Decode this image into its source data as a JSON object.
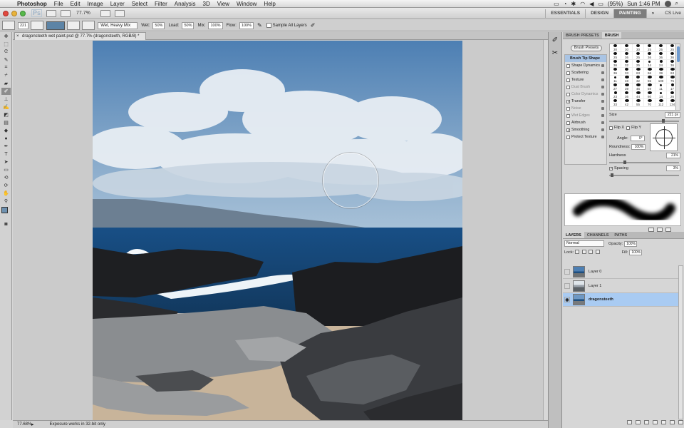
{
  "menubar": {
    "app": "Photoshop",
    "menus": [
      "File",
      "Edit",
      "Image",
      "Layer",
      "Select",
      "Filter",
      "Analysis",
      "3D",
      "View",
      "Window",
      "Help"
    ],
    "battery": "(95%)",
    "clock": "Sun 1:46 PM"
  },
  "appbar": {
    "logo": "Ps",
    "zoom": "77.7%",
    "workspaces": [
      "ESSENTIALS",
      "DESIGN",
      "PAINTING"
    ],
    "active_workspace": "PAINTING",
    "more": "»",
    "cs_live": "CS Live"
  },
  "options": {
    "brush_size": "221",
    "mix_preset": "Wet, Heavy Mix",
    "wet_label": "Wet:",
    "wet": "50%",
    "load_label": "Load:",
    "load": "50%",
    "mix_label": "Mix:",
    "mix": "100%",
    "flow_label": "Flow:",
    "flow": "100%",
    "sample_all": "Sample All Layers",
    "swatch_color": "#5d84a6"
  },
  "document": {
    "tab": "dragonsteeth wet paint.psd @ 77.7% (dragonsteeth, RGB/8) *"
  },
  "status": {
    "zoom": "77.68%",
    "message": "Exposure works in 32-bit only"
  },
  "brush_panel": {
    "tabs": [
      "BRUSH PRESETS",
      "BRUSH"
    ],
    "active_tab": "BRUSH",
    "presets_button": "Brush Presets",
    "options": [
      {
        "label": "Brush Tip Shape",
        "state": "head"
      },
      {
        "label": "Shape Dynamics",
        "state": "off"
      },
      {
        "label": "Scattering",
        "state": "off"
      },
      {
        "label": "Texture",
        "state": "off"
      },
      {
        "label": "Dual Brush",
        "state": "disabled"
      },
      {
        "label": "Color Dynamics",
        "state": "disabled"
      },
      {
        "label": "Transfer",
        "state": "on"
      },
      {
        "label": "Noise",
        "state": "disabled"
      },
      {
        "label": "Wet Edges",
        "state": "disabled"
      },
      {
        "label": "Airbrush",
        "state": "off"
      },
      {
        "label": "Smoothing",
        "state": "on"
      },
      {
        "label": "Protect Texture",
        "state": "off"
      }
    ],
    "tip_sizes": [
      "30",
      "30",
      "30",
      "25",
      "25",
      "25",
      "25",
      "36",
      "25",
      "36",
      "36",
      "36",
      "36",
      "32",
      "25",
      "14",
      "24",
      "36",
      "36",
      "33",
      "63",
      "66",
      "39",
      "63",
      "11",
      "48",
      "32",
      "55",
      "100",
      "75",
      "27",
      "39",
      "46",
      "59",
      "11",
      "17",
      "23",
      "36",
      "44",
      "60",
      "14",
      "26",
      "33",
      "42",
      "55",
      "70",
      "112",
      "134"
    ],
    "size_label": "Size",
    "size": "221 px",
    "flip_x": "Flip X",
    "flip_y": "Flip Y",
    "angle_label": "Angle:",
    "angle": "0°",
    "roundness_label": "Roundness:",
    "roundness": "100%",
    "hardness_label": "Hardness",
    "hardness": "21%",
    "spacing_label": "Spacing",
    "spacing": "3%"
  },
  "layers_panel": {
    "tabs": [
      "LAYERS",
      "CHANNELS",
      "PATHS"
    ],
    "active_tab": "LAYERS",
    "blend_mode": "Normal",
    "opacity_label": "Opacity:",
    "opacity": "100%",
    "lock_label": "Lock:",
    "fill_label": "Fill:",
    "fill": "100%",
    "layers": [
      {
        "name": "Layer 0",
        "visible": false,
        "selected": false
      },
      {
        "name": "Layer 1",
        "visible": false,
        "selected": false
      },
      {
        "name": "dragonsteeth",
        "visible": true,
        "selected": true
      }
    ]
  },
  "icons": {
    "tools": [
      "move-tool-icon",
      "marquee-tool-icon",
      "lasso-tool-icon",
      "quick-selection-icon",
      "crop-tool-icon",
      "eyedropper-icon",
      "healing-brush-icon",
      "brush-tool-icon",
      "clone-stamp-icon",
      "history-brush-icon",
      "eraser-icon",
      "gradient-icon",
      "blur-icon",
      "dodge-icon",
      "pen-icon",
      "type-tool-icon",
      "path-selection-icon",
      "shape-tool-icon",
      "3d-rotate-icon",
      "3d-orbit-icon",
      "hand-tool-icon",
      "zoom-tool-icon"
    ]
  }
}
